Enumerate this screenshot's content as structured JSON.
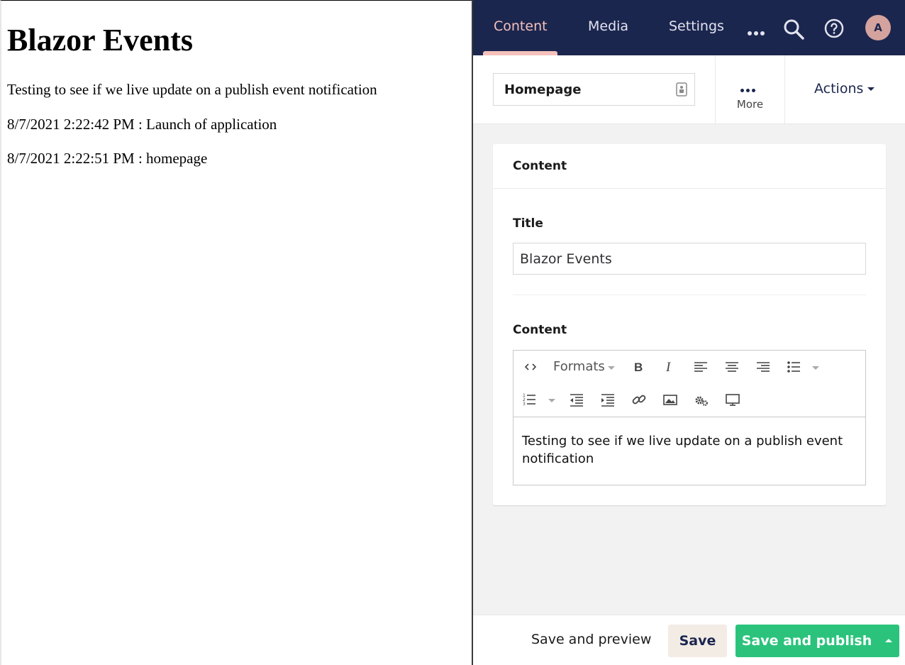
{
  "blazor_page": {
    "heading": "Blazor Events",
    "lines": [
      "Testing to see if we live update on a publish event notification",
      "8/7/2021 2:22:42 PM : Launch of application",
      "8/7/2021 2:22:51 PM : homepage"
    ]
  },
  "topbar": {
    "nav": [
      "Content",
      "Media",
      "Settings"
    ],
    "active_nav": "Content",
    "avatar_initial": "A",
    "icons": [
      "more-icon",
      "search-icon",
      "help-icon"
    ]
  },
  "editor_header": {
    "node_name": "Homepage",
    "more_label": "More",
    "actions_label": "Actions"
  },
  "card": {
    "group_title": "Content",
    "title_label": "Title",
    "title_value": "Blazor Events",
    "content_label": "Content",
    "rte": {
      "formats_label": "Formats",
      "toolbar_icons": [
        "source-code-icon",
        "bold-icon",
        "italic-icon",
        "align-left-icon",
        "align-center-icon",
        "align-right-icon",
        "bullet-list-icon",
        "numbered-list-icon",
        "outdent-icon",
        "indent-icon",
        "link-icon",
        "image-icon",
        "macro-icon",
        "embed-icon"
      ],
      "body_text": "Testing to see if we live update on a publish event notification"
    }
  },
  "footer": {
    "preview_label": "Save and preview",
    "save_label": "Save",
    "publish_label": "Save and publish"
  },
  "colors": {
    "topbar": "#1b264f",
    "active_nav": "#f5c1bc",
    "publish": "#2bc37c",
    "save": "#f3ece5"
  }
}
